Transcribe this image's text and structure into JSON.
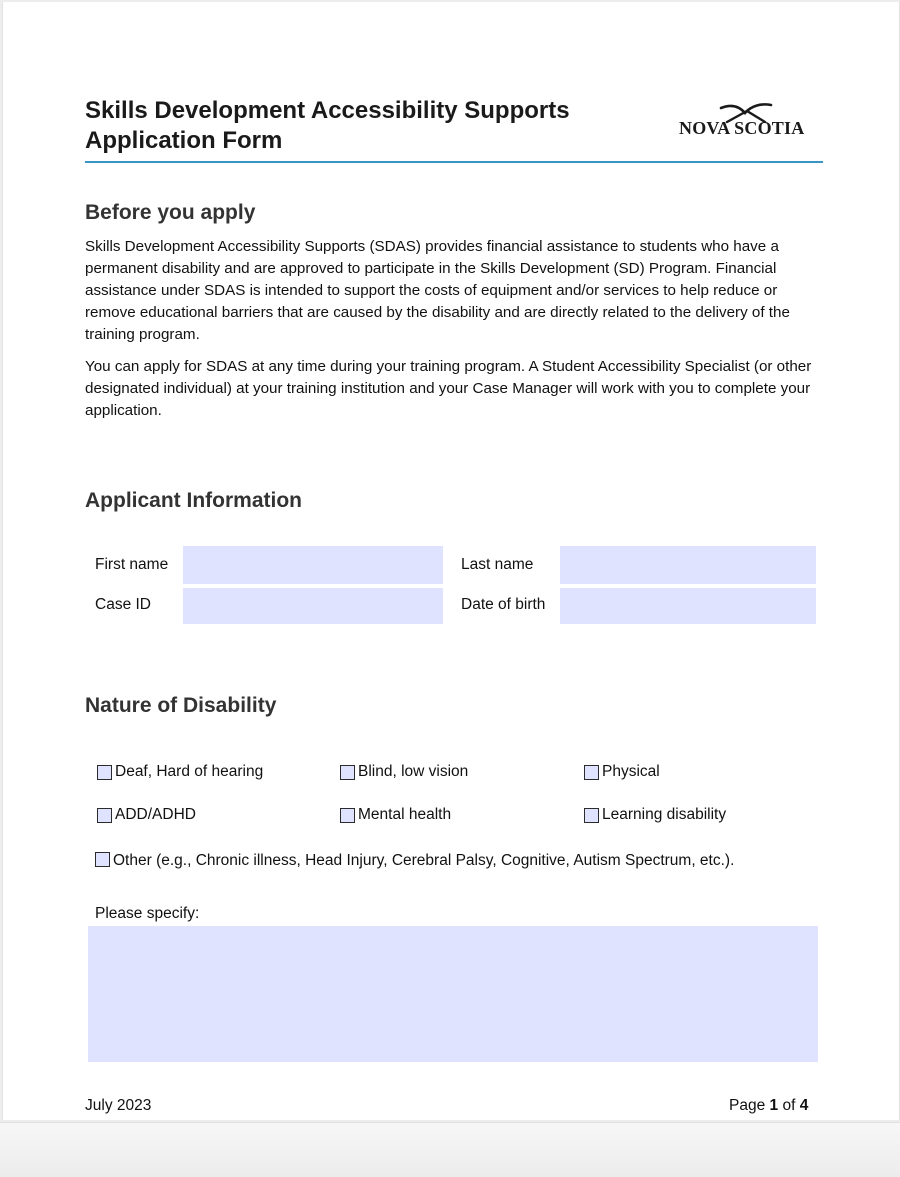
{
  "header": {
    "title_line1": "Skills Development Accessibility Supports",
    "title_line2": "Application Form",
    "logo_text": "NOVA SCOTIA",
    "accent_color": "#3a95c7"
  },
  "before_you_apply": {
    "heading": "Before you apply",
    "paragraph1": "Skills Development Accessibility Supports (SDAS) provides financial assistance to students who have a permanent disability and are approved to participate in the Skills Development (SD) Program. Financial assistance under SDAS is intended to support the costs of equipment and/or services to help reduce or remove educational barriers that are caused by the disability and are directly related to the delivery of the training program.",
    "paragraph2": "You can apply for SDAS at any time during your training program. A Student Accessibility Specialist (or other designated individual) at your training institution and your Case Manager will work with you to complete your application."
  },
  "applicant_information": {
    "heading": "Applicant Information",
    "first_name_label": "First name",
    "first_name_value": "",
    "last_name_label": "Last name",
    "last_name_value": "",
    "case_id_label": "Case ID",
    "case_id_value": "",
    "dob_label": "Date of birth",
    "dob_value": "",
    "field_color": "#dfe3ff"
  },
  "nature_of_disability": {
    "heading": "Nature of Disability",
    "options": [
      {
        "label": "Deaf, Hard of hearing",
        "checked": false
      },
      {
        "label": "Blind, low vision",
        "checked": false
      },
      {
        "label": "Physical",
        "checked": false
      },
      {
        "label": "ADD/ADHD",
        "checked": false
      },
      {
        "label": "Mental health",
        "checked": false
      },
      {
        "label": "Learning disability",
        "checked": false
      }
    ],
    "other_label": "Other (e.g., Chronic illness, Head Injury, Cerebral Palsy, Cognitive, Autism Spectrum, etc.).",
    "other_checked": false,
    "specify_label": "Please specify:",
    "specify_value": ""
  },
  "footer": {
    "date": "July 2023",
    "page_prefix": "Page",
    "page_current": "1",
    "page_of": "of",
    "page_total": "4"
  }
}
